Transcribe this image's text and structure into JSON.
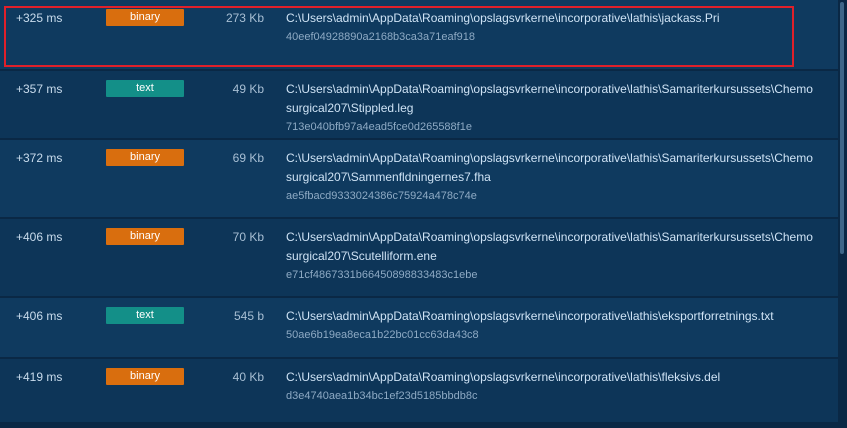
{
  "colors": {
    "binary": "#d96e0e",
    "text": "#138f88"
  },
  "rows": [
    {
      "time": "+325 ms",
      "kind": "binary",
      "size": "273 Kb",
      "path": "C:\\Users\\admin\\AppData\\Roaming\\opslagsvrkerne\\incorporative\\lathis\\jackass.Pri",
      "hash": "40eef04928890a2168b3ca3a71eaf918",
      "selected": true
    },
    {
      "time": "+357 ms",
      "kind": "text",
      "size": "49 Kb",
      "path": "C:\\Users\\admin\\AppData\\Roaming\\opslagsvrkerne\\incorporative\\lathis\\Samariterkursussets\\Chemosurgical207\\Stippled.leg",
      "hash": "713e040bfb97a4ead5fce0d265588f1e",
      "selected": false
    },
    {
      "time": "+372 ms",
      "kind": "binary",
      "size": "69 Kb",
      "path": "C:\\Users\\admin\\AppData\\Roaming\\opslagsvrkerne\\incorporative\\lathis\\Samariterkursussets\\Chemosurgical207\\Sammenfldningernes7.fha",
      "hash": "ae5fbacd9333024386c75924a478c74e",
      "selected": false
    },
    {
      "time": "+406 ms",
      "kind": "binary",
      "size": "70 Kb",
      "path": "C:\\Users\\admin\\AppData\\Roaming\\opslagsvrkerne\\incorporative\\lathis\\Samariterkursussets\\Chemosurgical207\\Scutelliform.ene",
      "hash": "e71cf4867331b664508988334 83c1ebe",
      "selected": false
    },
    {
      "time": "+406 ms",
      "kind": "text",
      "size": "545 b",
      "path": "C:\\Users\\admin\\AppData\\Roaming\\opslagsvrkerne\\incorporative\\lathis\\eksportforretnings.txt",
      "hash": "50ae6b19ea8eca1b22bc01cc63da43c8",
      "selected": false
    },
    {
      "time": "+419 ms",
      "kind": "binary",
      "size": "40 Kb",
      "path": "C:\\Users\\admin\\AppData\\Roaming\\opslagsvrkerne\\incorporative\\lathis\\fleksivs.del",
      "hash": "d3e4740aea1b34bc1ef23d5185bbdb8c",
      "selected": false
    }
  ]
}
